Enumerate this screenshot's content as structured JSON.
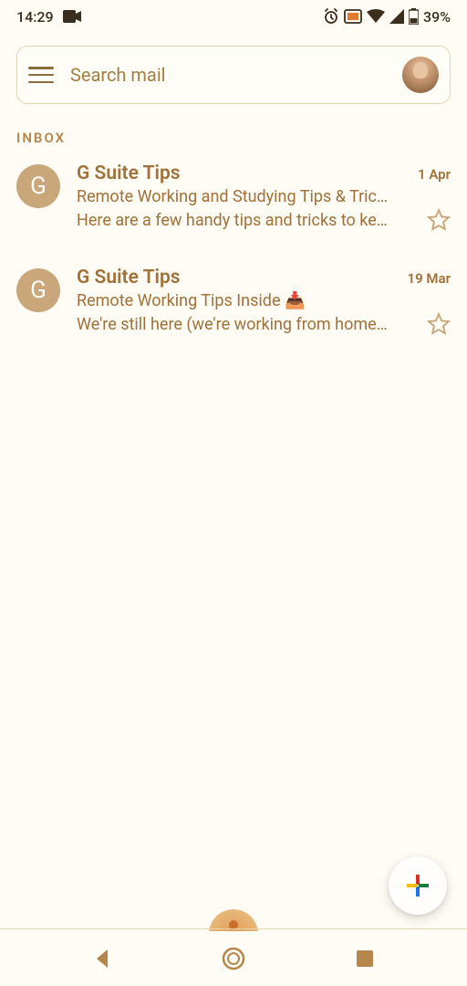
{
  "status_bar": {
    "time": "14:29",
    "battery_percent": "39%"
  },
  "search": {
    "placeholder": "Search mail"
  },
  "section_label": "INBOX",
  "emails": [
    {
      "avatar_letter": "G",
      "sender": "G Suite Tips",
      "date": "1 Apr",
      "subject": "Remote Working and Studying Tips & Tric…",
      "preview": "Here are a few handy tips and tricks to ke…"
    },
    {
      "avatar_letter": "G",
      "sender": "G Suite Tips",
      "date": "19 Mar",
      "subject": "Remote Working Tips Inside 📥",
      "preview": "We're still here (we're working from home…"
    }
  ],
  "colors": {
    "accent": "#a07138",
    "avatar_bg": "#c9a77a",
    "border": "#e8d4b0"
  }
}
